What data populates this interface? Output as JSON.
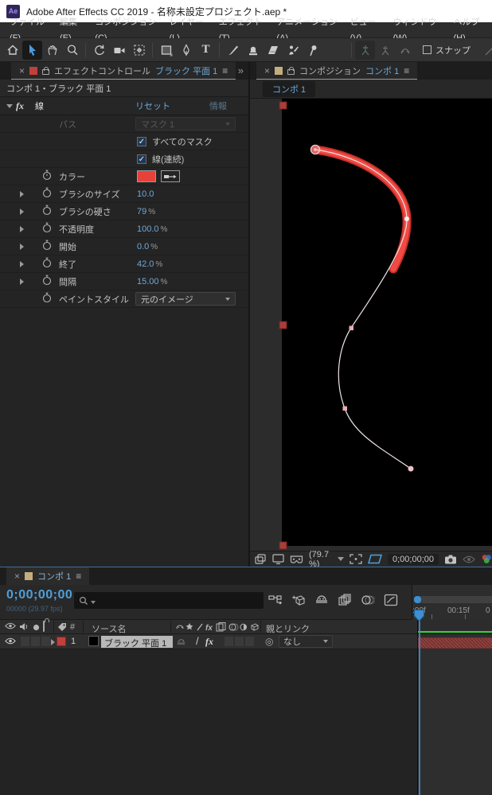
{
  "colors": {
    "value_blue": "#6da8d8",
    "stroke_red": "#e23b36",
    "label_red": "#c0403c",
    "comp_icon_tan": "#c5ad80",
    "cache_green": "#2fd42f",
    "layer_bar_red": "#9c4743",
    "playhead_blue": "#3d8fd1",
    "swatch_red": "#e8403a"
  },
  "title_bar": {
    "app_icon_label": "Ae",
    "title": "Adobe After Effects CC 2019 - 名称未設定プロジェクト.aep *"
  },
  "menu_bar": {
    "items": [
      "ファイル(F)",
      "編集(E)",
      "コンポジション(C)",
      "レイヤー(L)",
      "エフェクト(T)",
      "アニメーション(A)",
      "ビュー(V)",
      "ウィンドウ(W)",
      "ヘルプ(H)"
    ]
  },
  "toolbar": {
    "snap_label": "スナップ",
    "type_tool_glyph": "T"
  },
  "effect_controls": {
    "close_glyph": "×",
    "menu_glyph": "≡",
    "overflow_glyph": "»",
    "tab_title": "エフェクトコントロール",
    "tab_target": "ブラック 平面 1",
    "breadcrumb": "コンポ 1・ブラック 平面 1",
    "fx_badge": "fx",
    "effect_name": "線",
    "reset_label": "リセット",
    "info_label": "情報",
    "rows": {
      "path": {
        "label": "パス",
        "value": "マスク 1"
      },
      "all_masks": {
        "label": "すべてのマスク",
        "checked": "✓"
      },
      "stroke_seq": {
        "label": "線(連続)",
        "checked": "✓"
      },
      "color": {
        "label": "カラー"
      },
      "brush_size": {
        "label": "ブラシのサイズ",
        "value": "10.0",
        "unit": ""
      },
      "brush_hardness": {
        "label": "ブラシの硬さ",
        "value": "79",
        "unit": "%"
      },
      "opacity": {
        "label": "不透明度",
        "value": "100.0",
        "unit": "%"
      },
      "start": {
        "label": "開始",
        "value": "0.0",
        "unit": "%"
      },
      "end": {
        "label": "終了",
        "value": "42.0",
        "unit": "%"
      },
      "spacing": {
        "label": "間隔",
        "value": "15.00",
        "unit": "%"
      },
      "paint_style": {
        "label": "ペイントスタイル",
        "value": "元のイメージ"
      }
    }
  },
  "composition": {
    "close_glyph": "×",
    "menu_glyph": "≡",
    "tab_title": "コンポジション",
    "tab_target": "コンポ 1",
    "breadcrumb": "コンポ 1",
    "bottom_bar": {
      "zoom_level": "(79.7 %)",
      "timecode": "0;00;00;00"
    }
  },
  "timeline": {
    "close_glyph": "×",
    "menu_glyph": "≡",
    "tab_label": "コンポ 1",
    "timecode": "0;00;00;00",
    "frame_info": "00000 (29.97 fps)",
    "columns": {
      "source_name": "ソース名",
      "index": "#",
      "parent_link": "親とリンク"
    },
    "layer": {
      "index": "1",
      "name": "ブラック 平面 1",
      "quality_glyph": "/",
      "fx_badge": "fx",
      "parent_pickwhip": "◎",
      "parent_value": "なし"
    },
    "ruler": {
      "labels": [
        ":00f",
        "00:15f",
        "0"
      ]
    }
  }
}
